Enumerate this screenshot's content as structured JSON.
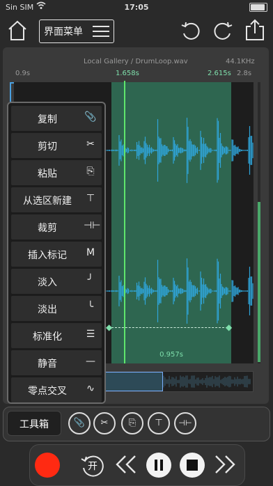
{
  "status_bar": {
    "carrier": "Sin SIM",
    "time": "17:05"
  },
  "top_bar": {
    "menu_label": "界面菜单"
  },
  "editor": {
    "file_path": "Local Gallery / DrumLoop.wav",
    "sample_rate": "44.1KHz",
    "view_start": "0.9s",
    "selection_start": "1.658s",
    "selection_end": "2.615s",
    "view_end": "2.8s",
    "selection_duration": "0.957s"
  },
  "context_menu": {
    "items": [
      {
        "label": "复制",
        "icon": "paperclip-icon",
        "glyph": "📎"
      },
      {
        "label": "剪切",
        "icon": "scissors-icon",
        "glyph": "✂"
      },
      {
        "label": "粘贴",
        "icon": "paste-icon",
        "glyph": "⎘"
      },
      {
        "label": "从选区新建",
        "icon": "new-from-selection-icon",
        "glyph": "⊤"
      },
      {
        "label": "裁剪",
        "icon": "trim-icon",
        "glyph": "⊣⊢"
      },
      {
        "label": "插入标记",
        "icon": "marker-icon",
        "glyph": "M"
      },
      {
        "label": "淡入",
        "icon": "fade-in-icon",
        "glyph": "╯"
      },
      {
        "label": "淡出",
        "icon": "fade-out-icon",
        "glyph": "╰"
      },
      {
        "label": "标准化",
        "icon": "normalize-icon",
        "glyph": "☰"
      },
      {
        "label": "静音",
        "icon": "silence-icon",
        "glyph": "—"
      },
      {
        "label": "零点交叉",
        "icon": "zero-crossing-icon",
        "glyph": "∿"
      }
    ]
  },
  "toolbox": {
    "label": "工具箱",
    "tools": [
      {
        "name": "paperclip-icon",
        "glyph": "📎"
      },
      {
        "name": "scissors-icon",
        "glyph": "✂"
      },
      {
        "name": "paste-icon",
        "glyph": "⎘"
      },
      {
        "name": "new-from-selection-icon",
        "glyph": "⊤"
      },
      {
        "name": "trim-icon",
        "glyph": "⊣⊢"
      }
    ]
  },
  "transport": {
    "loop_label": "开"
  },
  "colors": {
    "selection": "#2e6650",
    "waveform": "#2fa4d8",
    "playhead": "#5fe66c",
    "record": "#ff2a12"
  }
}
